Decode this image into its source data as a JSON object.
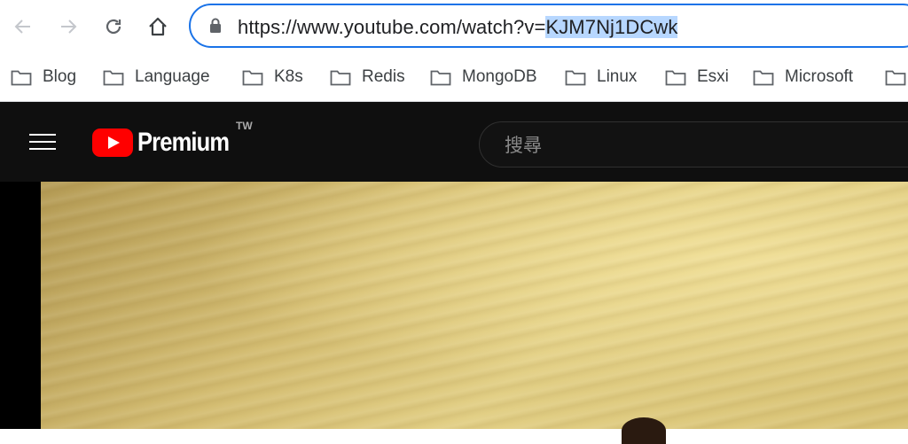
{
  "browser": {
    "url_base": "https://www.youtube.com/watch?v=",
    "url_selected": "KJM7Nj1DCwk"
  },
  "bookmarks": [
    {
      "label": "Blog",
      "icon": "folder-icon"
    },
    {
      "label": "Language",
      "icon": "folder-icon"
    },
    {
      "label": "K8s",
      "icon": "folder-icon"
    },
    {
      "label": "Redis",
      "icon": "folder-icon"
    },
    {
      "label": "MongoDB",
      "icon": "folder-icon"
    },
    {
      "label": "Linux",
      "icon": "folder-icon"
    },
    {
      "label": "Esxi",
      "icon": "folder-icon"
    },
    {
      "label": "Microsoft",
      "icon": "folder-icon"
    }
  ],
  "youtube": {
    "logo_text": "Premium",
    "region": "TW",
    "search_placeholder": "搜尋"
  },
  "colors": {
    "omnibox_border": "#1a73e8",
    "selection": "#b7d7ff",
    "yt_header_bg": "#0f0f0f",
    "yt_red": "#ff0000"
  }
}
